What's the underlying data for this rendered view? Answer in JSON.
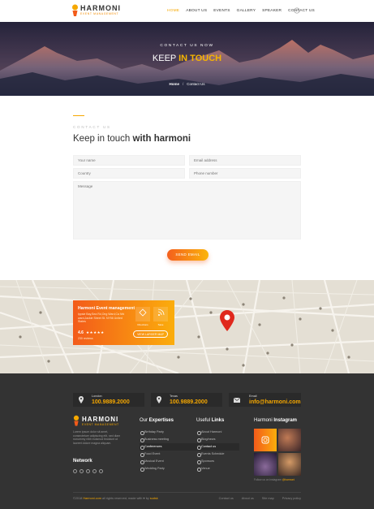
{
  "brand": {
    "name": "HARMONI",
    "tagline": "EVENT MANAGEMENT",
    "accent_color": "#f6a800",
    "gradient_start": "#f35b1a",
    "gradient_end": "#fbb40b"
  },
  "nav": {
    "items": [
      {
        "label": "HOME",
        "active": true
      },
      {
        "label": "ABOUT US",
        "active": false
      },
      {
        "label": "EVENTS",
        "active": false
      },
      {
        "label": "GALLERY",
        "active": false
      },
      {
        "label": "SPEAKER",
        "active": false
      },
      {
        "label": "CONTACT US",
        "active": false
      }
    ],
    "search_icon": "search-icon"
  },
  "hero": {
    "pretitle": "CONTACT US NOW",
    "title_plain": "KEEP ",
    "title_highlight": "IN TOUCH",
    "breadcrumb": {
      "home": "Home",
      "separator": "/",
      "current": "Contact Us"
    }
  },
  "contact": {
    "kicker": "CONTACT US",
    "title_plain": "Keep in touch ",
    "title_bold": "with harmoni",
    "fields": {
      "name_placeholder": "Your name",
      "email_placeholder": "Email address",
      "country_placeholder": "Country",
      "phone_placeholder": "Phone number",
      "message_placeholder": "Message"
    },
    "submit_label": "SEND EMAIL"
  },
  "map_card": {
    "title": "Harmoni Event management",
    "address": "Ippsie Bay,Sea Rd,Ong Ward,Ca Nhi ward,Jackie Street St. NY56 United States",
    "rating": "4.6",
    "stars": "★★★★★",
    "reviews": "230 reviews",
    "directions_label": "Directions",
    "save_label": "Save",
    "view_button": "VIEW LARGER MAP"
  },
  "footer": {
    "contacts": [
      {
        "icon": "location-pin-icon",
        "label": "London",
        "value": "100.9889.2000"
      },
      {
        "icon": "location-pin-icon",
        "label": "Texas",
        "value": "100.9889.2000"
      },
      {
        "icon": "envelope-icon",
        "label": "Email",
        "value": "info@harmoni.com"
      }
    ],
    "about_text": "Lorem ipsum dolor sit amet, consectetuer adipiscing elit, sed diam nonummy nibh euismod tincidunt ut laoreet dolore magna aliquam.",
    "network_heading": "Network",
    "social_icons": [
      "facebook-icon",
      "twitter-icon",
      "instagram-icon",
      "google-plus-icon",
      "youtube-icon"
    ],
    "expertises": {
      "heading_plain": "Our ",
      "heading_bold": "Expertises",
      "items": [
        {
          "label": "Birthday Party",
          "active": false
        },
        {
          "label": "Business meeting",
          "active": false
        },
        {
          "label": "Conferences",
          "active": true
        },
        {
          "label": "Food Event",
          "active": false
        },
        {
          "label": "Musical Event",
          "active": false
        },
        {
          "label": "Wedding Party",
          "active": false
        }
      ]
    },
    "useful_links": {
      "heading_plain": "Useful ",
      "heading_bold": "Links",
      "items": [
        {
          "label": "About Harmoni",
          "active": false
        },
        {
          "label": "Blog/news",
          "active": false
        },
        {
          "label": "Contact us",
          "active": true
        },
        {
          "label": "Events Schedule",
          "active": false
        },
        {
          "label": "Sponsors",
          "active": false
        },
        {
          "label": "Venue",
          "active": false
        }
      ]
    },
    "instagram": {
      "heading_plain": "Harmoni ",
      "heading_bold": "Instagram",
      "caption_plain": "Follow us on instagram ",
      "caption_handle": "@harmoni"
    },
    "copyright_plain_1": "©2018 ",
    "copyright_brand": "Harmoni.com",
    "copyright_plain_2": " all rights reserved, made with ♥ by ",
    "copyright_author": "sudsk",
    "bottom_links": [
      "Contact us",
      "About us",
      "Site map",
      "Privacy policy"
    ]
  }
}
